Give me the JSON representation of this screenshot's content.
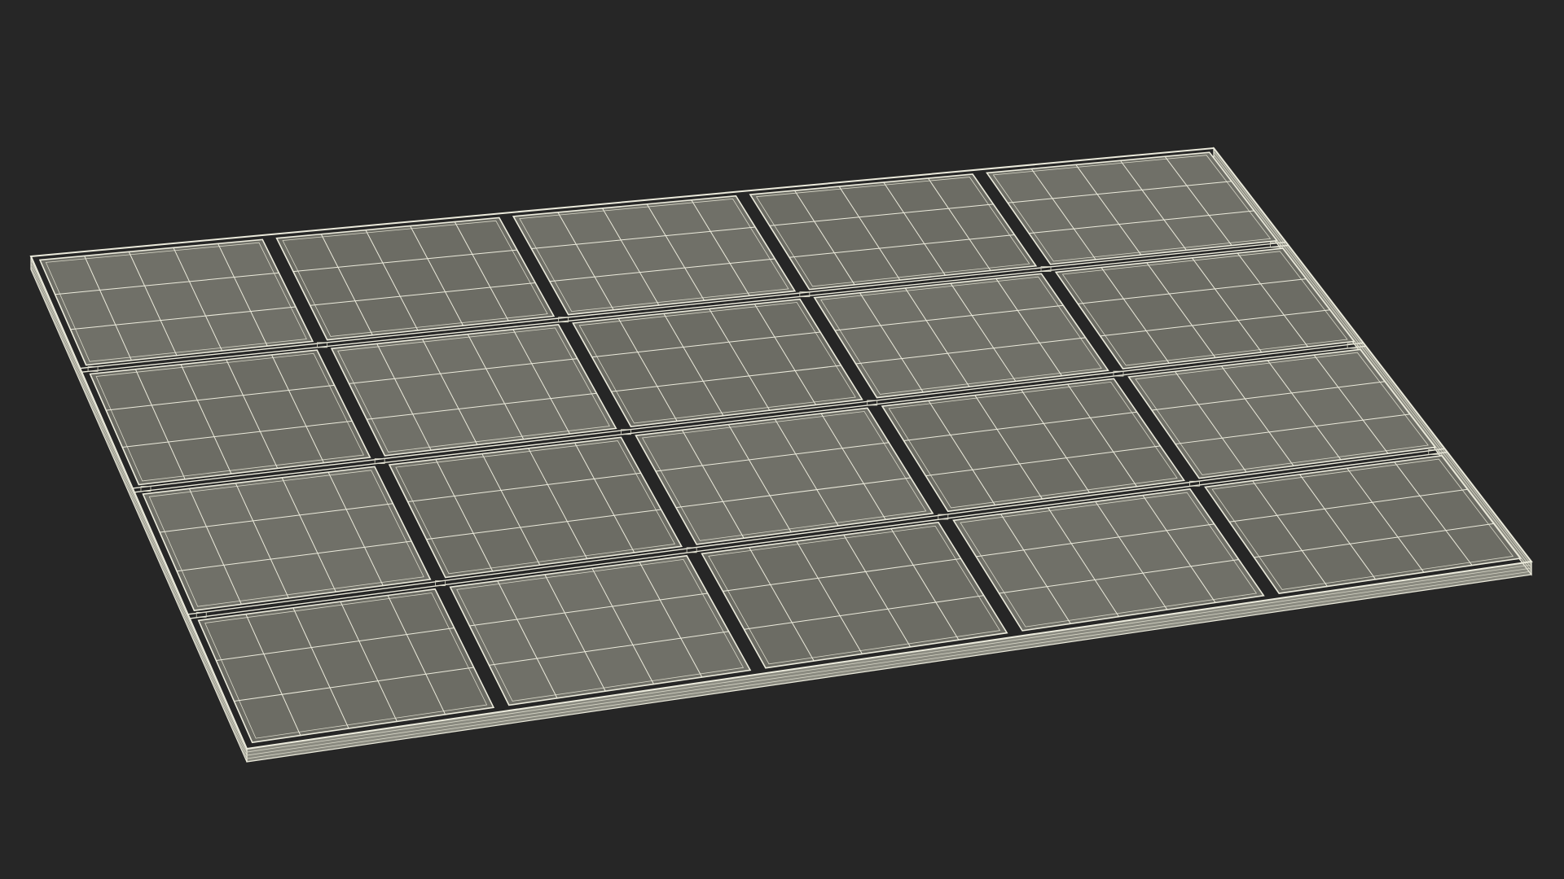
{
  "scene": {
    "subject": "solar-panel-array-wireframe",
    "render_mode": "wireframe",
    "panels": {
      "rows": 4,
      "cols": 5
    },
    "cells_per_panel": {
      "rows": 3,
      "cols": 5
    },
    "colors": {
      "background": "#262626",
      "panel_fill": "#707068",
      "panel_fill_alt": "#6c6c64",
      "wire": "#ecebdc",
      "wire_soft": "#d9d8c8",
      "frame_side": "#8a8a80"
    }
  }
}
